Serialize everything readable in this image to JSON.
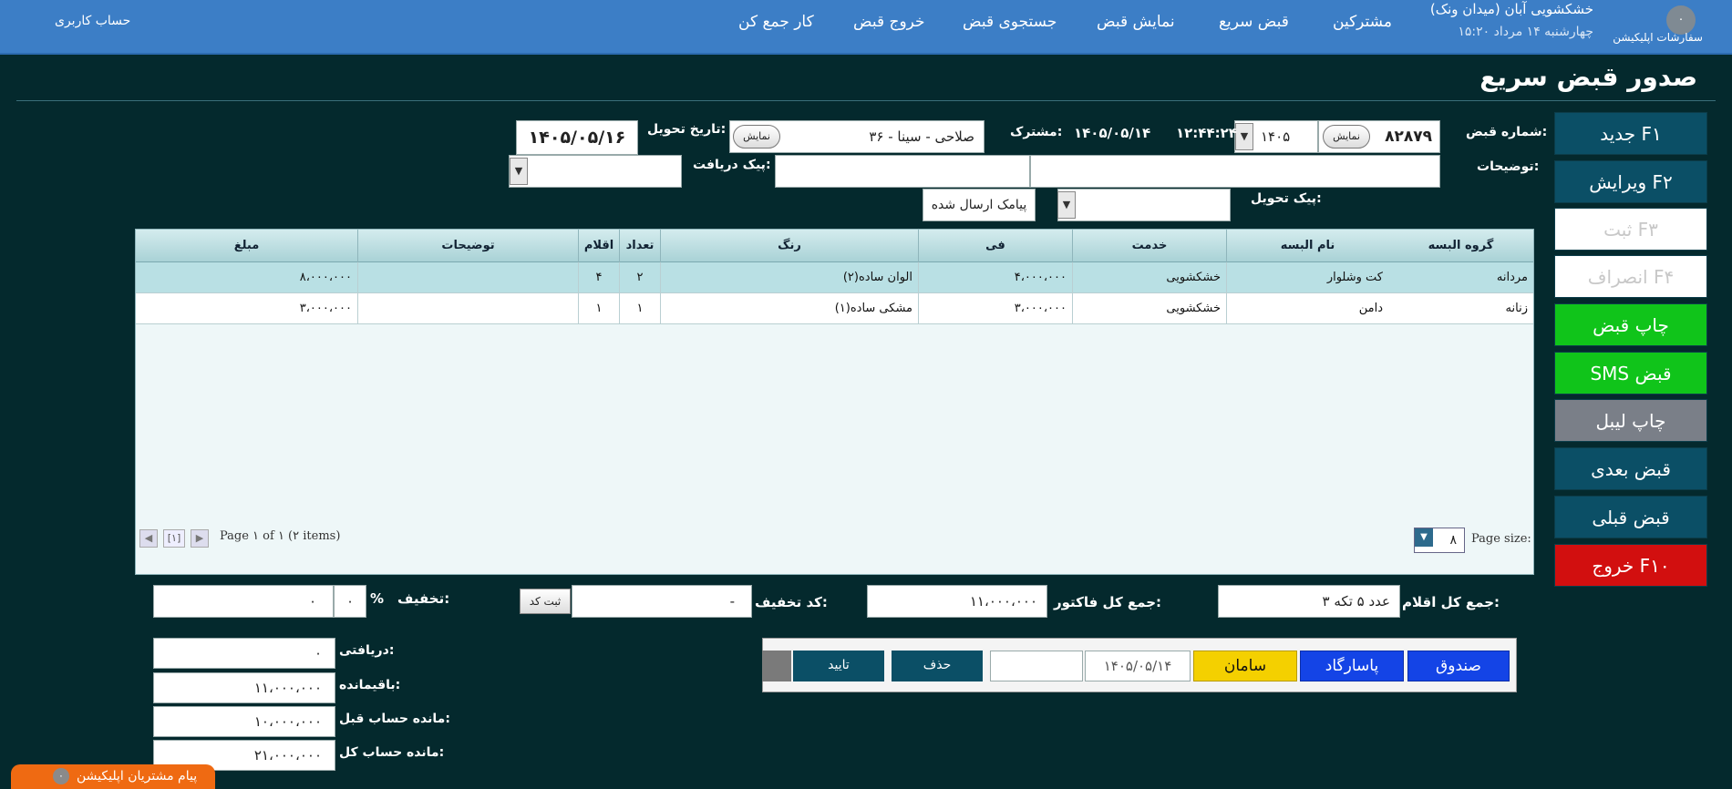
{
  "topbar": {
    "account": "حساب کاربری",
    "nav": [
      "کار جمع کن",
      "خروج قبض",
      "جستجوی قبض",
      "نمایش قبض",
      "قبض سریع",
      "مشترکین"
    ],
    "shop_name": "خشکشویی آبان (میدان ونک)",
    "shop_date": "چهارشنبه ۱۴ مرداد ۱۵:۲۰",
    "app_badge": "۰",
    "app_label": "سفارشات اپلیکیشن"
  },
  "page": {
    "title": "صدور قبض سریع"
  },
  "sidebar": {
    "buttons": [
      {
        "label": "جدید F۱",
        "color": "#0b4f66"
      },
      {
        "label": "ویرایش F۲",
        "color": "#0b4f66"
      },
      {
        "label": "ثبت F۳",
        "color": "#ffffff"
      },
      {
        "label": "انصراف F۴",
        "color": "#ffffff"
      },
      {
        "label": "چاپ قبض",
        "color": "#10c41a"
      },
      {
        "label": "SMS قبض",
        "color": "#10c41a"
      },
      {
        "label": "چاپ لیبل",
        "color": "#7a7f88"
      },
      {
        "label": "قبض بعدی",
        "color": "#0b4f66"
      },
      {
        "label": "قبض قبلی",
        "color": "#0b4f66"
      },
      {
        "label": "خروج F۱۰",
        "color": "#d20f0f"
      }
    ]
  },
  "form": {
    "receipt_no_label": "شماره قبض:",
    "receipt_no": "۸۲۸۷۹",
    "show_label": "نمایش",
    "year": "۱۴۰۵",
    "time": "۱۲:۴۴:۲۴",
    "date": "۱۴۰۵/۰۵/۱۴",
    "customer_label": "مشترک:",
    "customer": "۳۶ - صلاحی - سینا",
    "delivery_date_label": "تاریخ تحویل:",
    "delivery_date": "۱۴۰۵/۰۵/۱۶",
    "notes_label": "توضیحات:",
    "pickup_courier_label": "پیک دریافت:",
    "delivery_courier_label": "پیک تحویل:",
    "sms_status": "پیامک ارسال شده"
  },
  "table": {
    "headers": [
      "گروه البسه",
      "نام البسه",
      "خدمت",
      "فی",
      "رنگ",
      "تعداد",
      "اقلام",
      "توضیحات",
      "مبلغ"
    ],
    "rows": [
      [
        "مردانه",
        "کت وشلوار",
        "خشکشویی",
        "۴،۰۰۰،۰۰۰",
        "الوان ساده(۲)",
        "۲",
        "۴",
        "",
        "۸،۰۰۰،۰۰۰"
      ],
      [
        "زنانه",
        "دامن",
        "خشکشویی",
        "۳،۰۰۰،۰۰۰",
        "مشکی ساده(۱)",
        "۱",
        "۱",
        "",
        "۳،۰۰۰،۰۰۰"
      ]
    ],
    "page_size_label": "Page size:",
    "page_size": "۸",
    "page_info": "Page ۱ of ۱ (۲ items)",
    "page_num": "[۱]"
  },
  "totals": {
    "items_label": "جمع کل اقلام:",
    "items_value": "۳ عدد ۵ تکه",
    "invoice_label": "جمع کل فاکتور:",
    "invoice_value": "۱۱،۰۰۰،۰۰۰",
    "discount_code_label": "کد تخفیف:",
    "discount_code_value": "-",
    "discount_code_btn": "ثبت کد",
    "discount_label": "تخفیف:",
    "discount_pct_sign": "%",
    "discount_pct": "۰",
    "discount_value": "۰",
    "received_label": "دریافتی:",
    "received_value": "۰",
    "remaining_label": "باقیمانده:",
    "remaining_value": "۱۱،۰۰۰،۰۰۰",
    "prev_balance_label": "مانده حساب قبل:",
    "prev_balance_value": "۱۰،۰۰۰،۰۰۰",
    "total_balance_label": "مانده حساب کل:",
    "total_balance_value": "۲۱،۰۰۰،۰۰۰"
  },
  "payment": {
    "methods": [
      {
        "label": "صندوق",
        "color": "#1444e6"
      },
      {
        "label": "پاسارگاد",
        "color": "#1444e6"
      },
      {
        "label": "سامان",
        "color": "#f4d000"
      }
    ],
    "date": "۱۴۰۵/۰۵/۱۴",
    "delete_label": "حذف",
    "confirm_label": "تایید"
  },
  "footer": {
    "app_messages": "پیام مشتریان اپلیکیشن",
    "badge": "۰"
  }
}
